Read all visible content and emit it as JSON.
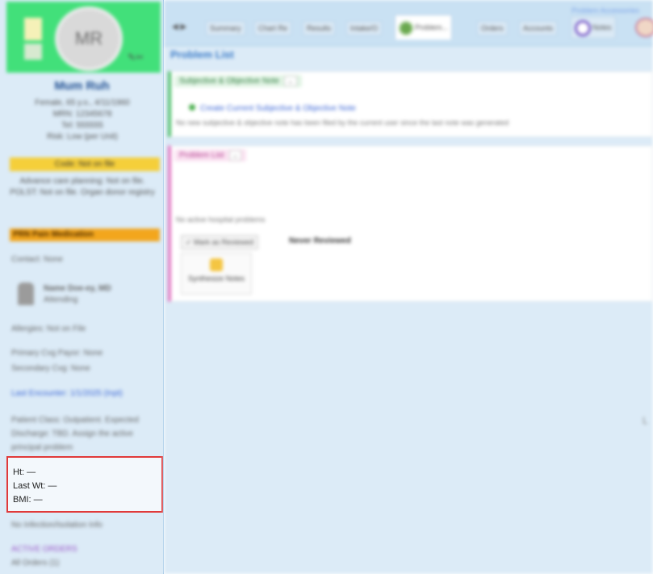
{
  "patient": {
    "initials": "MR",
    "name": "Mum Ruh",
    "lines": [
      "Female, 65 y.o., 4/11/1960",
      "MRN: 12345678",
      "Tel: 555555",
      "Risk: Low (per Unit)"
    ],
    "code_status": "Code: Not on file",
    "note": "Advance care planning: Not on file. POLST: Not on file. Organ donor registry",
    "alert_bar": "PRN Pain Medication",
    "contact": "Contact: None",
    "provider_name": "Name Doe-ey, MD",
    "provider_role": "Attending",
    "allergies": "Allergies: Not on File",
    "primary_payor": "Primary Cvg Payor: None",
    "secondary_payor": "Secondary Cvg: None",
    "link_text": "Last Encounter: 1/1/2025 (Inpt)",
    "expected_discharge": "Patient Class: Outpatient. Expected Discharge: TBD. Assign the active principal problem",
    "vitals": {
      "ht": "Ht: —",
      "last_wt": "Last Wt: —",
      "bmi": "BMI: —"
    },
    "bottom_text": "No Infection/Isolation Info",
    "bottom_purple": "ACTIVE ORDERS",
    "bottom_text2": "All Orders (1)"
  },
  "nav": {
    "arrows": "◀  ▶",
    "tabs": [
      "Summary",
      "Chart Re",
      "Results",
      "Intake/O",
      "Problem...",
      "Orders",
      "Accounts",
      "Notes"
    ],
    "active_tab": "Problem...",
    "top_link": "Problem Accessories"
  },
  "page": {
    "title": "Problem List",
    "soap_section": {
      "header": "Subjective & Objective Note",
      "collapse": "⌄",
      "link": "Create Current Subjective & Objective Note",
      "description": "No new subjective & objective note has been filed by the current user since the last note was generated"
    },
    "problem_section": {
      "header": "Problem List",
      "collapse": "⌄",
      "none_text": "No active hospital problems",
      "mark_button": "✓ Mark as Reviewed",
      "never_text": "Never Reviewed",
      "synth_button": "Synthesize Notes"
    },
    "right_marker": "L"
  },
  "colors": {
    "sidebar_bg": "#dcebf7",
    "avatar_bg": "#42e07a",
    "code_status": "#f5cf3a",
    "alert_bar": "#f3a61d",
    "highlight_border": "#e03a3a",
    "soap_accent": "#4fbf6a",
    "problem_accent": "#e376c1",
    "title": "#3a7bc8"
  },
  "icons": {
    "note": "sticky-note-icon",
    "tools": "tools-icon",
    "provider": "person-icon",
    "tab_problem": "problem-list-icon",
    "tab_notes": "notes-icon",
    "link": "add-note-icon",
    "synth": "synthesize-icon"
  }
}
